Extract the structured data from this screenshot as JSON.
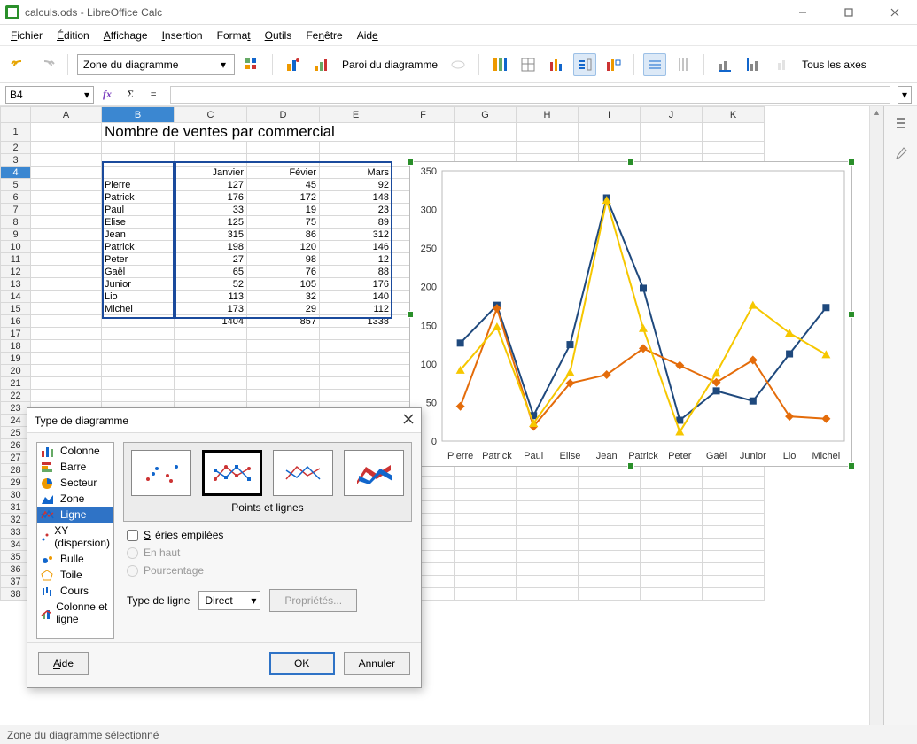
{
  "title": "calculs.ods - LibreOffice Calc",
  "menu": [
    "Fichier",
    "Édition",
    "Affichage",
    "Insertion",
    "Format",
    "Outils",
    "Fenêtre",
    "Aide"
  ],
  "toolbar": {
    "zone_label": "Zone du diagramme",
    "paroi_label": "Paroi du diagramme",
    "axes_label": "Tous les axes"
  },
  "namebox": "B4",
  "columns": [
    "A",
    "B",
    "C",
    "D",
    "E",
    "F",
    "G",
    "H",
    "I",
    "J",
    "K"
  ],
  "sheet": {
    "title_cell": "Nombre de ventes par commercial",
    "header_row": [
      "",
      "Janvier",
      "Févier",
      "Mars"
    ],
    "rows": [
      [
        "Pierre",
        127,
        45,
        92
      ],
      [
        "Patrick",
        176,
        172,
        148
      ],
      [
        "Paul",
        33,
        19,
        23
      ],
      [
        "Elise",
        125,
        75,
        89
      ],
      [
        "Jean",
        315,
        86,
        312
      ],
      [
        "Patrick",
        198,
        120,
        146
      ],
      [
        "Peter",
        27,
        98,
        12
      ],
      [
        "Gaël",
        65,
        76,
        88
      ],
      [
        "Junior",
        52,
        105,
        176
      ],
      [
        "Lio",
        113,
        32,
        140
      ],
      [
        "Michel",
        173,
        29,
        112
      ]
    ],
    "totals": [
      1404,
      857,
      1338
    ]
  },
  "chart_data": {
    "type": "line",
    "categories": [
      "Pierre",
      "Patrick",
      "Paul",
      "Elise",
      "Jean",
      "Patrick",
      "Peter",
      "Gaël",
      "Junior",
      "Lio",
      "Michel"
    ],
    "series": [
      {
        "name": "Janvier",
        "color": "#1f497d",
        "values": [
          127,
          176,
          33,
          125,
          315,
          198,
          27,
          65,
          52,
          113,
          173
        ]
      },
      {
        "name": "Févier",
        "color": "#e46c0a",
        "values": [
          45,
          172,
          19,
          75,
          86,
          120,
          98,
          76,
          105,
          32,
          29
        ]
      },
      {
        "name": "Mars",
        "color": "#f6c700",
        "values": [
          92,
          148,
          23,
          89,
          312,
          146,
          12,
          88,
          176,
          140,
          112
        ]
      }
    ],
    "ylim": [
      0,
      350
    ],
    "yticks": [
      0,
      50,
      100,
      150,
      200,
      250,
      300,
      350
    ]
  },
  "dialog": {
    "title": "Type de diagramme",
    "types": [
      "Colonne",
      "Barre",
      "Secteur",
      "Zone",
      "Ligne",
      "XY (dispersion)",
      "Bulle",
      "Toile",
      "Cours",
      "Colonne et ligne"
    ],
    "selected_type": "Ligne",
    "subtype_caption": "Points et lignes",
    "stacked_label": "Séries empilées",
    "opt_top": "En haut",
    "opt_pct": "Pourcentage",
    "line_type_label": "Type de ligne",
    "line_type_value": "Direct",
    "props_btn": "Propriétés...",
    "help": "Aide",
    "ok": "OK",
    "cancel": "Annuler"
  },
  "statusbar": "Zone du diagramme sélectionné"
}
